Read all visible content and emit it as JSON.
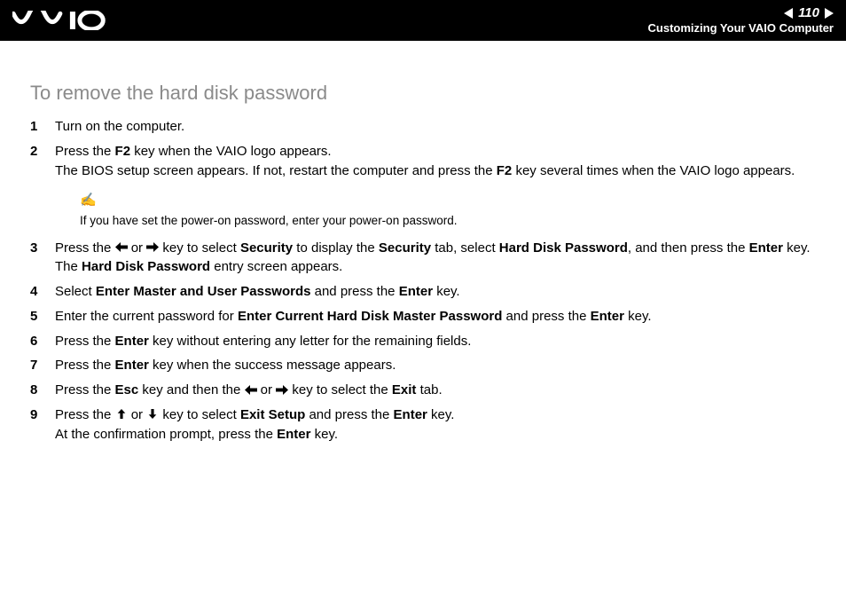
{
  "header": {
    "page_number": "110",
    "section": "Customizing Your VAIO Computer"
  },
  "title": "To remove the hard disk password",
  "note": {
    "text": "If you have set the power-on password, enter your power-on password."
  },
  "steps": {
    "s1": "Turn on the computer.",
    "s2a": "Press the ",
    "s2b": "F2",
    "s2c": " key when the VAIO logo appears.",
    "s2d": "The BIOS setup screen appears. If not, restart the computer and press the ",
    "s2e": "F2",
    "s2f": " key several times when the VAIO logo appears.",
    "s3a": "Press the ",
    "s3b": " or ",
    "s3c": " key to select ",
    "s3d": "Security",
    "s3e": " to display the ",
    "s3f": "Security",
    "s3g": " tab, select ",
    "s3h": "Hard Disk Password",
    "s3i": ", and then press the ",
    "s3j": "Enter",
    "s3k": " key.",
    "s3l": "The ",
    "s3m": "Hard Disk Password",
    "s3n": " entry screen appears.",
    "s4a": "Select ",
    "s4b": "Enter Master and User Passwords",
    "s4c": " and press the ",
    "s4d": "Enter",
    "s4e": " key.",
    "s5a": "Enter the current password for ",
    "s5b": "Enter Current Hard Disk Master Password",
    "s5c": " and press the ",
    "s5d": "Enter",
    "s5e": " key.",
    "s6a": "Press the ",
    "s6b": "Enter",
    "s6c": " key without entering any letter for the remaining fields.",
    "s7a": "Press the ",
    "s7b": "Enter",
    "s7c": " key when the success message appears.",
    "s8a": "Press the ",
    "s8b": "Esc",
    "s8c": " key and then the ",
    "s8d": " or ",
    "s8e": " key to select the ",
    "s8f": "Exit",
    "s8g": " tab.",
    "s9a": "Press the ",
    "s9b": " or ",
    "s9c": " key to select ",
    "s9d": "Exit Setup",
    "s9e": " and press the ",
    "s9f": "Enter",
    "s9g": " key.",
    "s9h": "At the confirmation prompt, press the ",
    "s9i": "Enter",
    "s9j": " key."
  }
}
